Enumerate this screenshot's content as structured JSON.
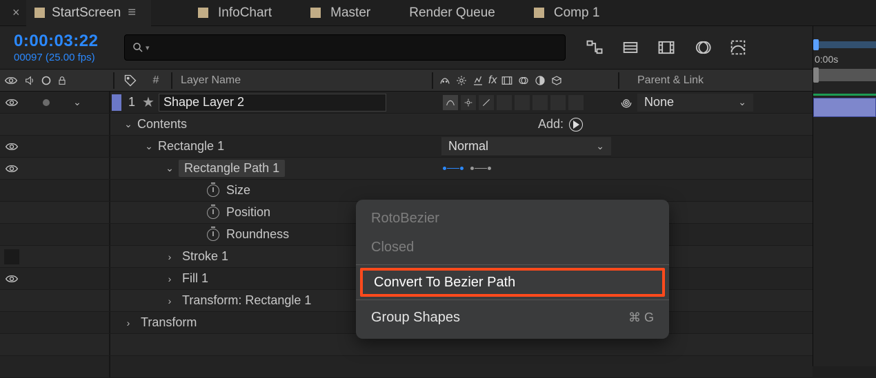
{
  "tabs": {
    "close_glyph": "×",
    "active": "StartScreen",
    "menu_glyph": "≡",
    "items": [
      "InfoChart",
      "Master",
      "Render Queue",
      "Comp 1"
    ]
  },
  "timecode": {
    "main": "0:00:03:22",
    "sub": "00097 (25.00 fps)"
  },
  "timeline": {
    "tick0": "0:00s"
  },
  "columns": {
    "idx": "#",
    "layer_name": "Layer Name",
    "parent": "Parent & Link"
  },
  "layer": {
    "index": "1",
    "name": "Shape Layer 2",
    "parent": "None"
  },
  "tree": {
    "contents": "Contents",
    "add": "Add:",
    "rect1": "Rectangle 1",
    "mode": "Normal",
    "rectpath1": "Rectangle Path 1",
    "size": "Size",
    "position": "Position",
    "roundness": "Roundness",
    "stroke1": "Stroke 1",
    "fill1": "Fill 1",
    "transform_rect": "Transform: Rectangle 1",
    "transform": "Transform"
  },
  "ctxmenu": {
    "rotobezier": "RotoBezier",
    "closed": "Closed",
    "convert": "Convert To Bezier Path",
    "group": "Group Shapes",
    "group_shortcut": "⌘ G"
  }
}
